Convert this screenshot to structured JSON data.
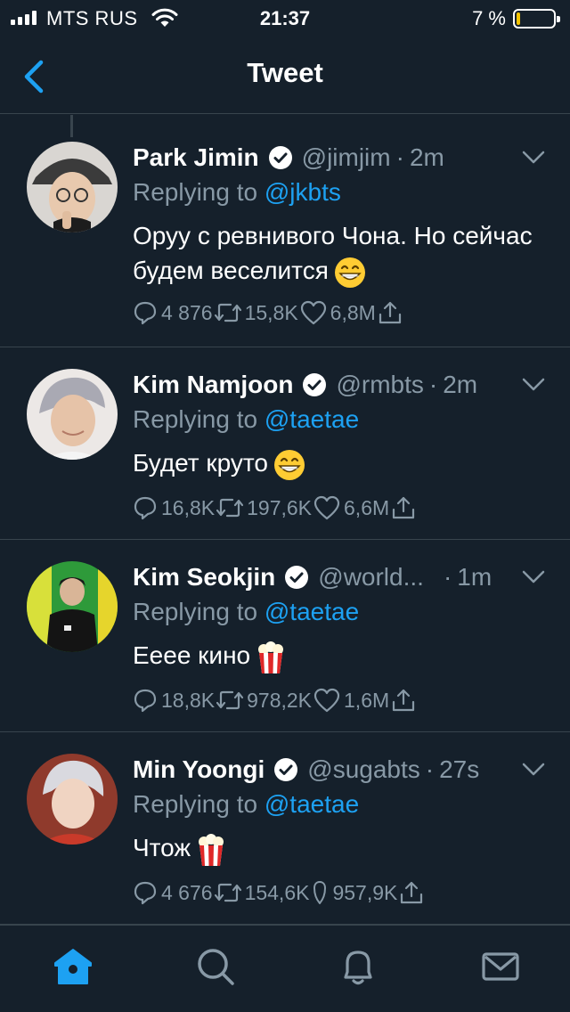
{
  "status_bar": {
    "carrier": "MTS RUS",
    "time": "21:37",
    "battery_percent": "7 %",
    "battery_level": 0.07
  },
  "nav": {
    "title": "Tweet",
    "back_icon": "chevron-left-icon"
  },
  "colors": {
    "background": "#15202b",
    "accent": "#1da1f2",
    "muted": "#8899a6",
    "divider": "#38444d",
    "battery_low": "#f5c400"
  },
  "tweets": [
    {
      "name": "Park Jimin",
      "handle": "@jimjim",
      "time": "2m",
      "replying_prefix": "Replying to",
      "replying_to": "@jkbts",
      "text": "Оруу с ревнивого Чона. Но сейчас будем веселится",
      "emoji": "grinning-face",
      "replies": "4 876",
      "retweets": "15,8K",
      "likes": "6,8M"
    },
    {
      "name": "Kim Namjoon",
      "handle": "@rmbts",
      "time": "2m",
      "replying_prefix": "Replying to",
      "replying_to": "@taetae",
      "text": "Будет круто",
      "emoji": "grinning-face",
      "replies": "16,8K",
      "retweets": "197,6K",
      "likes": "6,6M"
    },
    {
      "name": "Kim Seokjin",
      "handle": "@world...",
      "time": "1m",
      "replying_prefix": "Replying to",
      "replying_to": "@taetae",
      "text": "Ееее кино",
      "emoji": "popcorn",
      "replies": "18,8K",
      "retweets": "978,2K",
      "likes": "1,6M"
    },
    {
      "name": "Min Yoongi",
      "handle": "@sugabts",
      "time": "27s",
      "replying_prefix": "Replying to",
      "replying_to": "@taetae",
      "text": "Чтож",
      "emoji": "popcorn",
      "replies": "4 676",
      "retweets": "154,6K",
      "likes": "957,9K"
    }
  ],
  "tabbar": {
    "items": [
      "home-icon",
      "search-icon",
      "bell-icon",
      "mail-icon"
    ],
    "active": "home-icon"
  }
}
